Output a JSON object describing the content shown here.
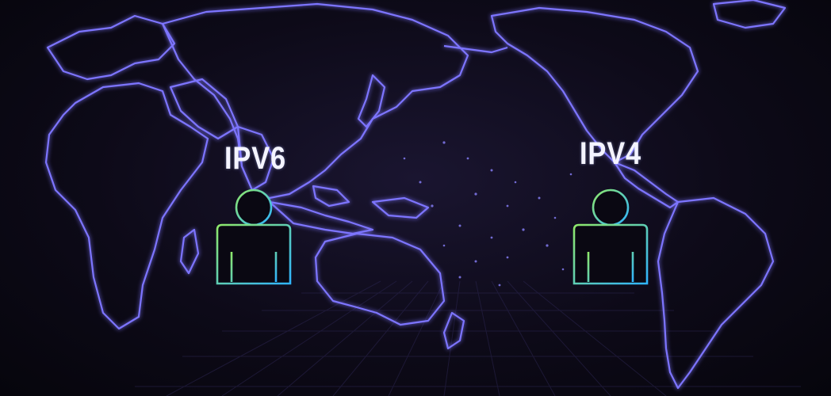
{
  "nodes": [
    {
      "label": "IPV6",
      "icon": "person-icon"
    },
    {
      "label": "IPV4",
      "icon": "person-icon"
    }
  ],
  "colors": {
    "background": "#0d0a18",
    "map_glow": "#6f63ff",
    "map_line": "#8a82ff",
    "icon_gradient_start": "#8fe86a",
    "icon_gradient_end": "#2fb4ff",
    "label": "#f4f4ff"
  },
  "decoration": [
    "world-map",
    "perspective-grid"
  ]
}
